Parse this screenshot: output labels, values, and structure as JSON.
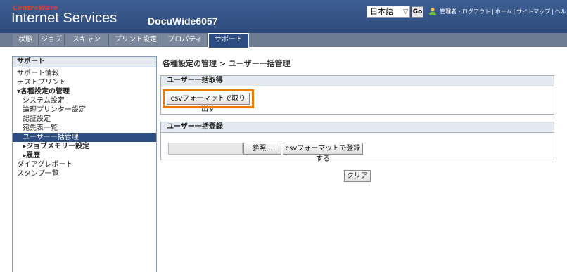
{
  "header": {
    "brand_top": "CentreWare",
    "brand_main": "Internet Services",
    "model": "DocuWide6057",
    "language": "日本語",
    "go_label": "Go",
    "links": {
      "admin": "管理者・ログアウト",
      "home": "ホーム",
      "sitemap": "サイトマップ",
      "help": "ヘルプ"
    }
  },
  "tabs": [
    "状態",
    "ジョブ",
    "スキャン",
    "プリント設定",
    "プロパティ",
    "サポート"
  ],
  "nav": {
    "title": "サポート",
    "items": [
      "サポート情報",
      "テストプリント",
      "▾各種設定の管理",
      "システム設定",
      "論理プリンター設定",
      "認証設定",
      "宛先表一覧",
      "ユーザー一括管理",
      "▸ジョブメモリー設定",
      "▸履歴",
      "ダイアグレポート",
      "スタンプ一覧"
    ]
  },
  "main": {
    "title": "各種設定の管理 > ユーザー一括管理",
    "export_panel": {
      "title": "ユーザー一括取得",
      "export_button": "csvフォーマットで取り出す"
    },
    "import_panel": {
      "title": "ユーザー一括登録",
      "browse_button": "参照...",
      "register_button": "csvフォーマットで登録する"
    },
    "clear_button": "クリア"
  }
}
